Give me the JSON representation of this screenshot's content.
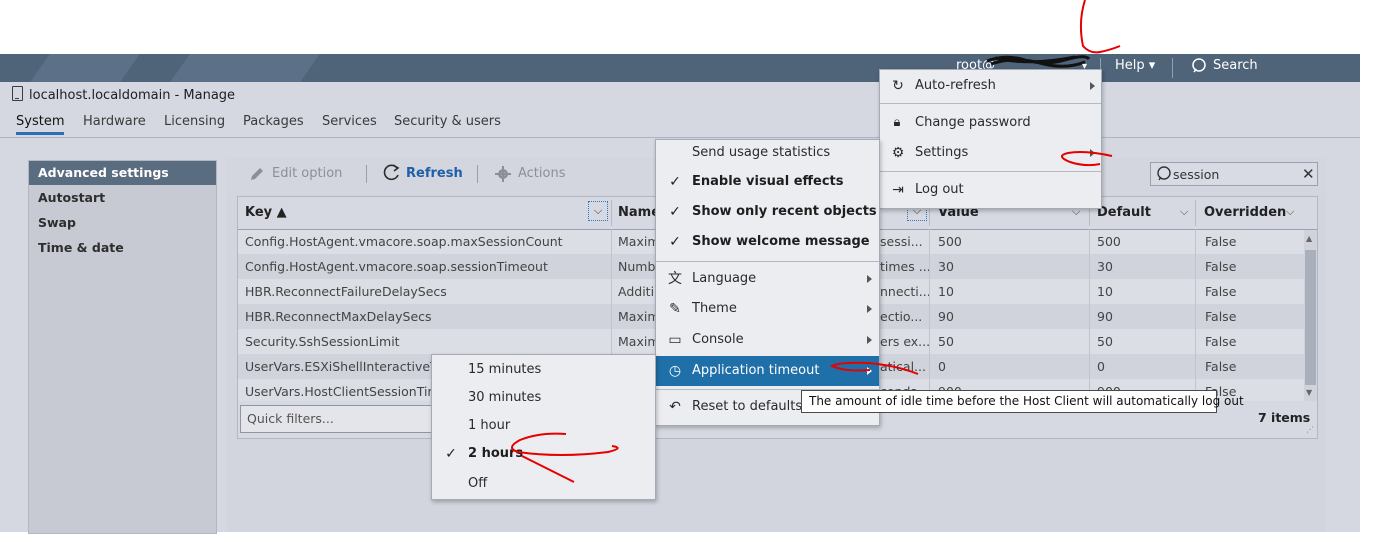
{
  "header": {
    "user": "root@",
    "help": "Help ▾",
    "search": "Search"
  },
  "title": "localhost.localdomain - Manage",
  "tabs": [
    "System",
    "Hardware",
    "Licensing",
    "Packages",
    "Services",
    "Security & users"
  ],
  "sidebar": {
    "items": [
      "Advanced settings",
      "Autostart",
      "Swap",
      "Time & date"
    ]
  },
  "toolbar": {
    "edit": "Edit option",
    "refresh": "Refresh",
    "actions": "Actions"
  },
  "search": {
    "value": "session"
  },
  "table": {
    "headers": [
      "Key ▲",
      "Name",
      "Value",
      "Default",
      "Overridden"
    ],
    "rows": [
      [
        "Config.HostAgent.vmacore.soap.maxSessionCount",
        "Maxim",
        "sessi...",
        "500",
        "500",
        "False"
      ],
      [
        "Config.HostAgent.vmacore.soap.sessionTimeout",
        "Numb",
        "times ...",
        "30",
        "30",
        "False"
      ],
      [
        "HBR.ReconnectFailureDelaySecs",
        "Additi",
        "nnecti...",
        "10",
        "10",
        "False"
      ],
      [
        "HBR.ReconnectMaxDelaySecs",
        "Maxim",
        "ectio...",
        "90",
        "90",
        "False"
      ],
      [
        "Security.SshSessionLimit",
        "Maxim",
        "ers ex...",
        "50",
        "50",
        "False"
      ],
      [
        "UserVars.ESXiShellInteractiveTi",
        "",
        "atical...",
        "0",
        "0",
        "False"
      ],
      [
        "UserVars.HostClientSessionTim",
        "",
        "conds...",
        "900",
        "900",
        "False"
      ]
    ],
    "quick_filters_placeholder": "Quick filters...",
    "item_count": "7 items"
  },
  "user_menu": {
    "items": [
      "Auto-refresh",
      "Change password",
      "Settings",
      "Log out"
    ]
  },
  "settings_menu": {
    "items": [
      "Send usage statistics",
      "Enable visual effects",
      "Show only recent objects",
      "Show welcome message",
      "Language",
      "Theme",
      "Console",
      "Application timeout",
      "Reset to defaults"
    ]
  },
  "timeout_menu": {
    "items": [
      "15 minutes",
      "30 minutes",
      "1 hour",
      "2 hours",
      "Off"
    ],
    "selected": "2 hours"
  },
  "tooltip": "The amount of idle time before the Host Client will automatically log out",
  "colors": {
    "header_bg": "#4f6379",
    "nav_active": "#596c80",
    "highlight": "#1f6fa9",
    "annotation": "#e60000"
  }
}
